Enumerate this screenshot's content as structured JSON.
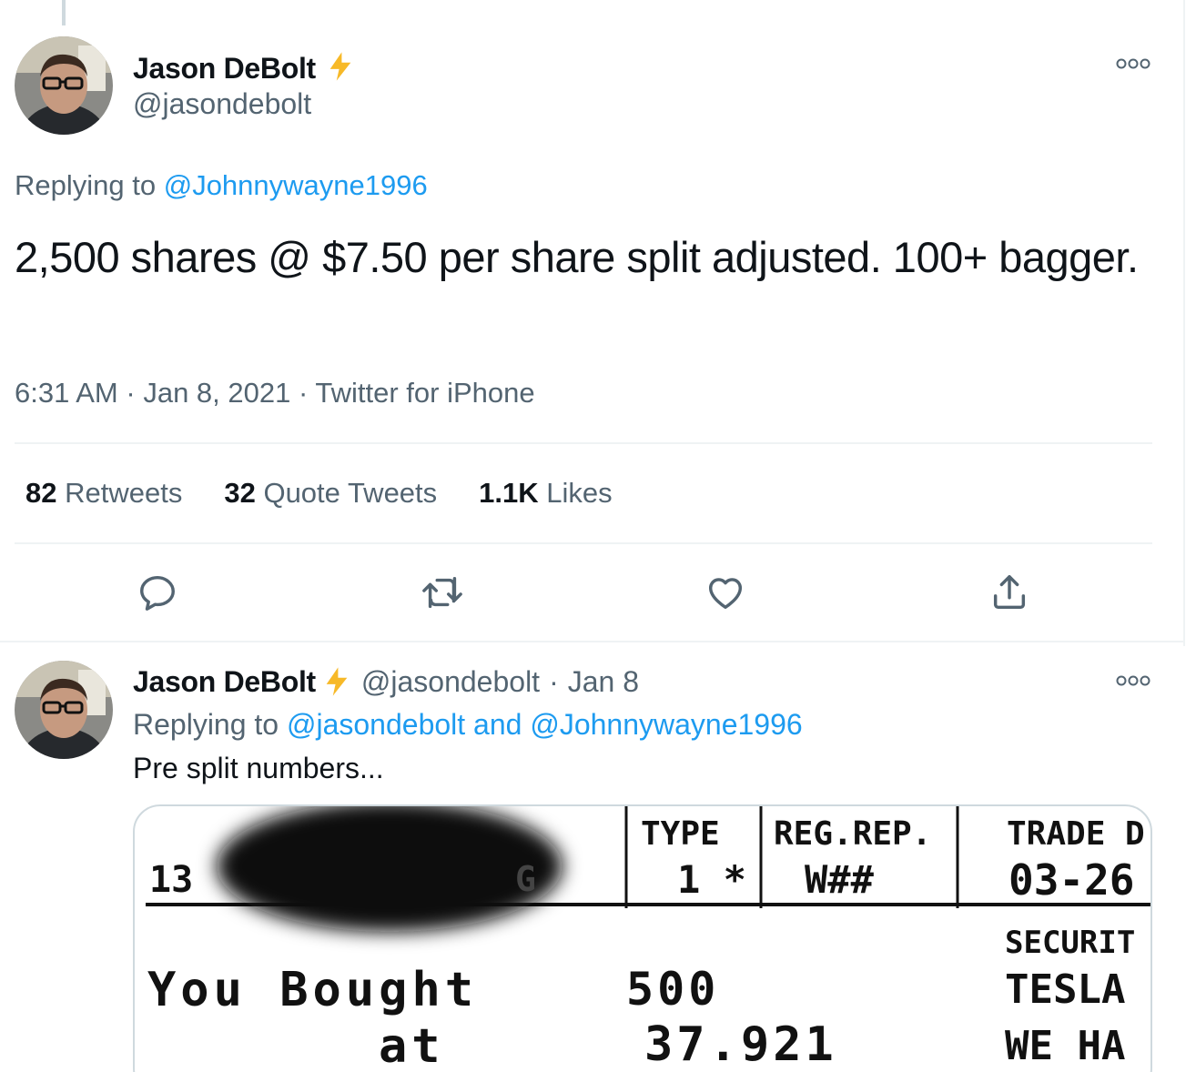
{
  "main_tweet": {
    "author": {
      "name": "Jason DeBolt",
      "handle": "@jasondebolt",
      "badge": "lightning-bolt-icon"
    },
    "replying_label": "Replying to",
    "replying_to": "@Johnnywayne1996",
    "text": "2,500 shares @ $7.50 per share split adjusted. 100+ bagger.",
    "time": "6:31 AM",
    "date": "Jan 8, 2021",
    "source": "Twitter for iPhone",
    "separator": "·",
    "stats": [
      {
        "count": "82",
        "label": "Retweets"
      },
      {
        "count": "32",
        "label": "Quote Tweets"
      },
      {
        "count": "1.1K",
        "label": "Likes"
      }
    ],
    "actions": [
      "reply-icon",
      "retweet-icon",
      "like-icon",
      "share-icon"
    ]
  },
  "reply_tweet": {
    "author": {
      "name": "Jason DeBolt",
      "handle": "@jasondebolt",
      "badge": "lightning-bolt-icon"
    },
    "separator": "·",
    "date": "Jan 8",
    "replying_label": "Replying to",
    "replying_to": "@jasondebolt and @Johnnywayne1996",
    "text": "Pre split numbers...",
    "media": {
      "headers": [
        "TYPE",
        "REG.REP.",
        "TRADE D"
      ],
      "values": [
        "1 *",
        "W##",
        "03-26"
      ],
      "account_fragment": "13",
      "account_fragment_end": "G",
      "action_line1": "You Bought",
      "action_line2": "at",
      "quantity": "500",
      "price": "37.921",
      "security_label": "SECURIT",
      "security_name": "TESLA",
      "note_fragment": "WE HA"
    }
  },
  "colors": {
    "accent": "#1d9bf0",
    "muted": "#536471",
    "bolt": "#f7b928"
  }
}
